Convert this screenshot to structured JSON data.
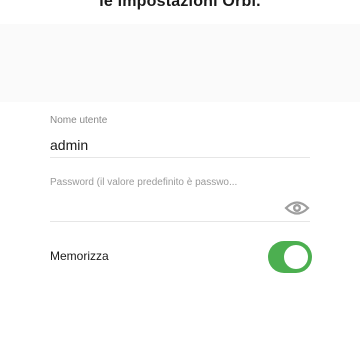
{
  "header": {
    "text": "le impostazioni Orbi."
  },
  "username": {
    "label": "Nome utente",
    "value": "admin"
  },
  "password": {
    "placeholder": "Password (il valore predefinito è passwo..."
  },
  "remember": {
    "label": "Memorizza",
    "enabled": true
  },
  "icons": {
    "password_visibility": "eye-icon"
  },
  "colors": {
    "toggle_on": "#4caf50",
    "icon": "#9e9e9e",
    "label": "#888888",
    "divider": "#e6e6e6"
  }
}
